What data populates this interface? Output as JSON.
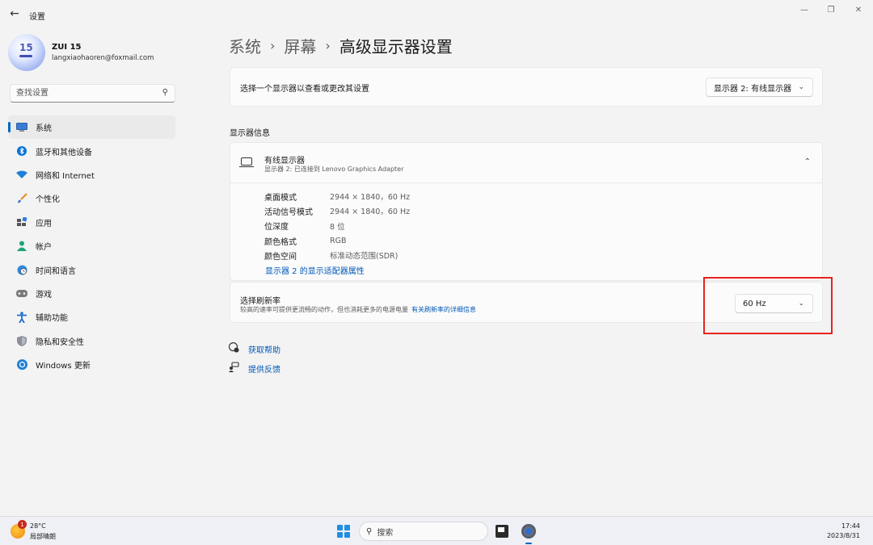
{
  "window": {
    "title": "设置",
    "back_icon": "back-arrow-icon",
    "controls": [
      "minimize-icon",
      "restore-icon",
      "close-icon"
    ]
  },
  "profile": {
    "avatar_text": "15",
    "name": "ZUI 15",
    "email": "langxiaohaoren@foxmail.com"
  },
  "search": {
    "placeholder": "查找设置",
    "icon": "search-icon"
  },
  "sidebar": {
    "items": [
      {
        "label": "系统",
        "icon": "monitor-icon",
        "active": true
      },
      {
        "label": "蓝牙和其他设备",
        "icon": "bluetooth-icon",
        "active": false
      },
      {
        "label": "网络和 Internet",
        "icon": "wifi-icon",
        "active": false
      },
      {
        "label": "个性化",
        "icon": "brush-icon",
        "active": false
      },
      {
        "label": "应用",
        "icon": "apps-icon",
        "active": false
      },
      {
        "label": "帐户",
        "icon": "account-icon",
        "active": false
      },
      {
        "label": "时间和语言",
        "icon": "globe-clock-icon",
        "active": false
      },
      {
        "label": "游戏",
        "icon": "gamepad-icon",
        "active": false
      },
      {
        "label": "辅助功能",
        "icon": "accessibility-icon",
        "active": false
      },
      {
        "label": "隐私和安全性",
        "icon": "shield-icon",
        "active": false
      },
      {
        "label": "Windows 更新",
        "icon": "update-icon",
        "active": false
      }
    ]
  },
  "breadcrumb": {
    "part1": "系统",
    "part2": "屏幕",
    "current": "高级显示器设置"
  },
  "display_select": {
    "label": "选择一个显示器以查看或更改其设置",
    "value": "显示器 2: 有线显示器"
  },
  "section": {
    "title": "显示器信息"
  },
  "display_info": {
    "name": "有线显示器",
    "subtitle": "显示器 2: 已连接到 Lenovo Graphics Adapter",
    "props": [
      {
        "key": "桌面模式",
        "value": "2944 × 1840，60 Hz"
      },
      {
        "key": "活动信号模式",
        "value": "2944 × 1840，60 Hz"
      },
      {
        "key": "位深度",
        "value": "8 位"
      },
      {
        "key": "颜色格式",
        "value": "RGB"
      },
      {
        "key": "颜色空间",
        "value": "标准动态范围(SDR)"
      }
    ],
    "adapter_link": "显示器 2 的显示适配器属性"
  },
  "refresh": {
    "title": "选择刷新率",
    "desc": "较高的速率可提供更流畅的动作，但也消耗更多的电源电量",
    "link": "有关刷新率的详细信息",
    "value": "60 Hz"
  },
  "help": {
    "get_help": "获取帮助",
    "feedback": "提供反馈"
  },
  "taskbar": {
    "weather_badge": "1",
    "weather_temp": "28°C",
    "weather_desc": "局部晴朗",
    "search_label": "搜索",
    "time": "17:44",
    "date": "2023/8/31"
  },
  "colors": {
    "accent": "#0067c0",
    "link": "#0058b8",
    "highlight_box": "#e8231e",
    "background": "#f3f3f3",
    "card": "#fbfbfb"
  }
}
